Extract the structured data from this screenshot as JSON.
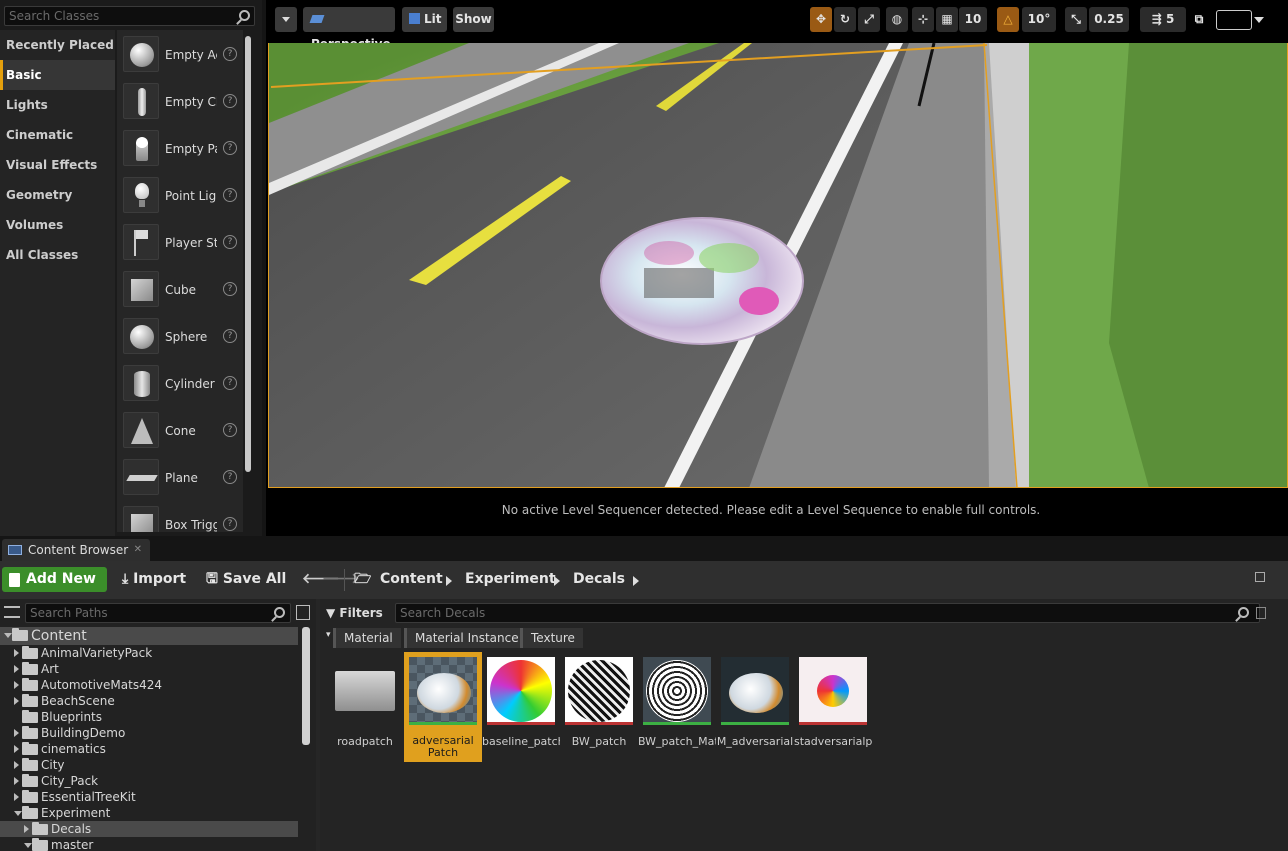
{
  "place_actors": {
    "search_placeholder": "Search Classes",
    "categories": [
      "Recently Placed",
      "Basic",
      "Lights",
      "Cinematic",
      "Visual Effects",
      "Geometry",
      "Volumes",
      "All Classes"
    ],
    "selected_category": "Basic",
    "actors": [
      {
        "label": "Empty Actor",
        "icon": "sphere-icon"
      },
      {
        "label": "Empty Character",
        "icon": "character-icon"
      },
      {
        "label": "Empty Pawn",
        "icon": "pawn-icon"
      },
      {
        "label": "Point Light",
        "icon": "light-bulb-icon"
      },
      {
        "label": "Player Start",
        "icon": "player-start-icon"
      },
      {
        "label": "Cube",
        "icon": "cube-icon"
      },
      {
        "label": "Sphere",
        "icon": "sphere-icon"
      },
      {
        "label": "Cylinder",
        "icon": "cylinder-icon"
      },
      {
        "label": "Cone",
        "icon": "cone-icon"
      },
      {
        "label": "Plane",
        "icon": "plane-icon"
      },
      {
        "label": "Box Trigger",
        "icon": "box-trigger-icon"
      }
    ],
    "help_glyph": "?"
  },
  "viewport": {
    "perspective_label": "Perspective",
    "lit_label": "Lit",
    "show_label": "Show",
    "grid_snap": "10",
    "rotation_snap": "10°",
    "scale_snap": "0.25",
    "camera_speed": "5",
    "sequencer_message": "No active Level Sequencer detected. Please edit a Level Sequence to enable full controls.",
    "selection_color": "#e39f21"
  },
  "content_browser": {
    "tab_label": "Content Browser",
    "add_new_label": "Add New",
    "import_label": "Import",
    "save_all_label": "Save All",
    "breadcrumb": [
      "Content",
      "Experiment",
      "Decals"
    ],
    "search_paths_placeholder": "Search Paths",
    "filters_label": "Filters",
    "search_decals_placeholder": "Search Decals",
    "filter_chips": [
      "Material",
      "Material Instance",
      "Texture"
    ],
    "tree": [
      {
        "label": "Content",
        "level": 0,
        "expanded": true,
        "root": true
      },
      {
        "label": "AnimalVarietyPack",
        "level": 1
      },
      {
        "label": "Art",
        "level": 1
      },
      {
        "label": "AutomotiveMats424",
        "level": 1
      },
      {
        "label": "BeachScene",
        "level": 1
      },
      {
        "label": "Blueprints",
        "level": 1,
        "no_arrow": true
      },
      {
        "label": "BuildingDemo",
        "level": 1
      },
      {
        "label": "cinematics",
        "level": 1
      },
      {
        "label": "City",
        "level": 1
      },
      {
        "label": "City_Pack",
        "level": 1
      },
      {
        "label": "EssentialTreeKit",
        "level": 1
      },
      {
        "label": "Experiment",
        "level": 1,
        "expanded": true
      },
      {
        "label": "Decals",
        "level": 2,
        "selected": true
      },
      {
        "label": "master",
        "level": 2,
        "expanded": true
      }
    ],
    "assets": [
      {
        "label": "roadpatch",
        "type": "folder"
      },
      {
        "label": "adversarial Patch",
        "type": "material",
        "selected": true
      },
      {
        "label": "baseline_patch",
        "type": "texture"
      },
      {
        "label": "BW_patch",
        "type": "texture"
      },
      {
        "label": "BW_patch_Mat",
        "type": "material"
      },
      {
        "label": "M_adversarial",
        "type": "material"
      },
      {
        "label": "stadversarialpa",
        "type": "texture"
      }
    ],
    "accent_green": "#3b8e2a",
    "selection_orange": "#e0a01e"
  }
}
